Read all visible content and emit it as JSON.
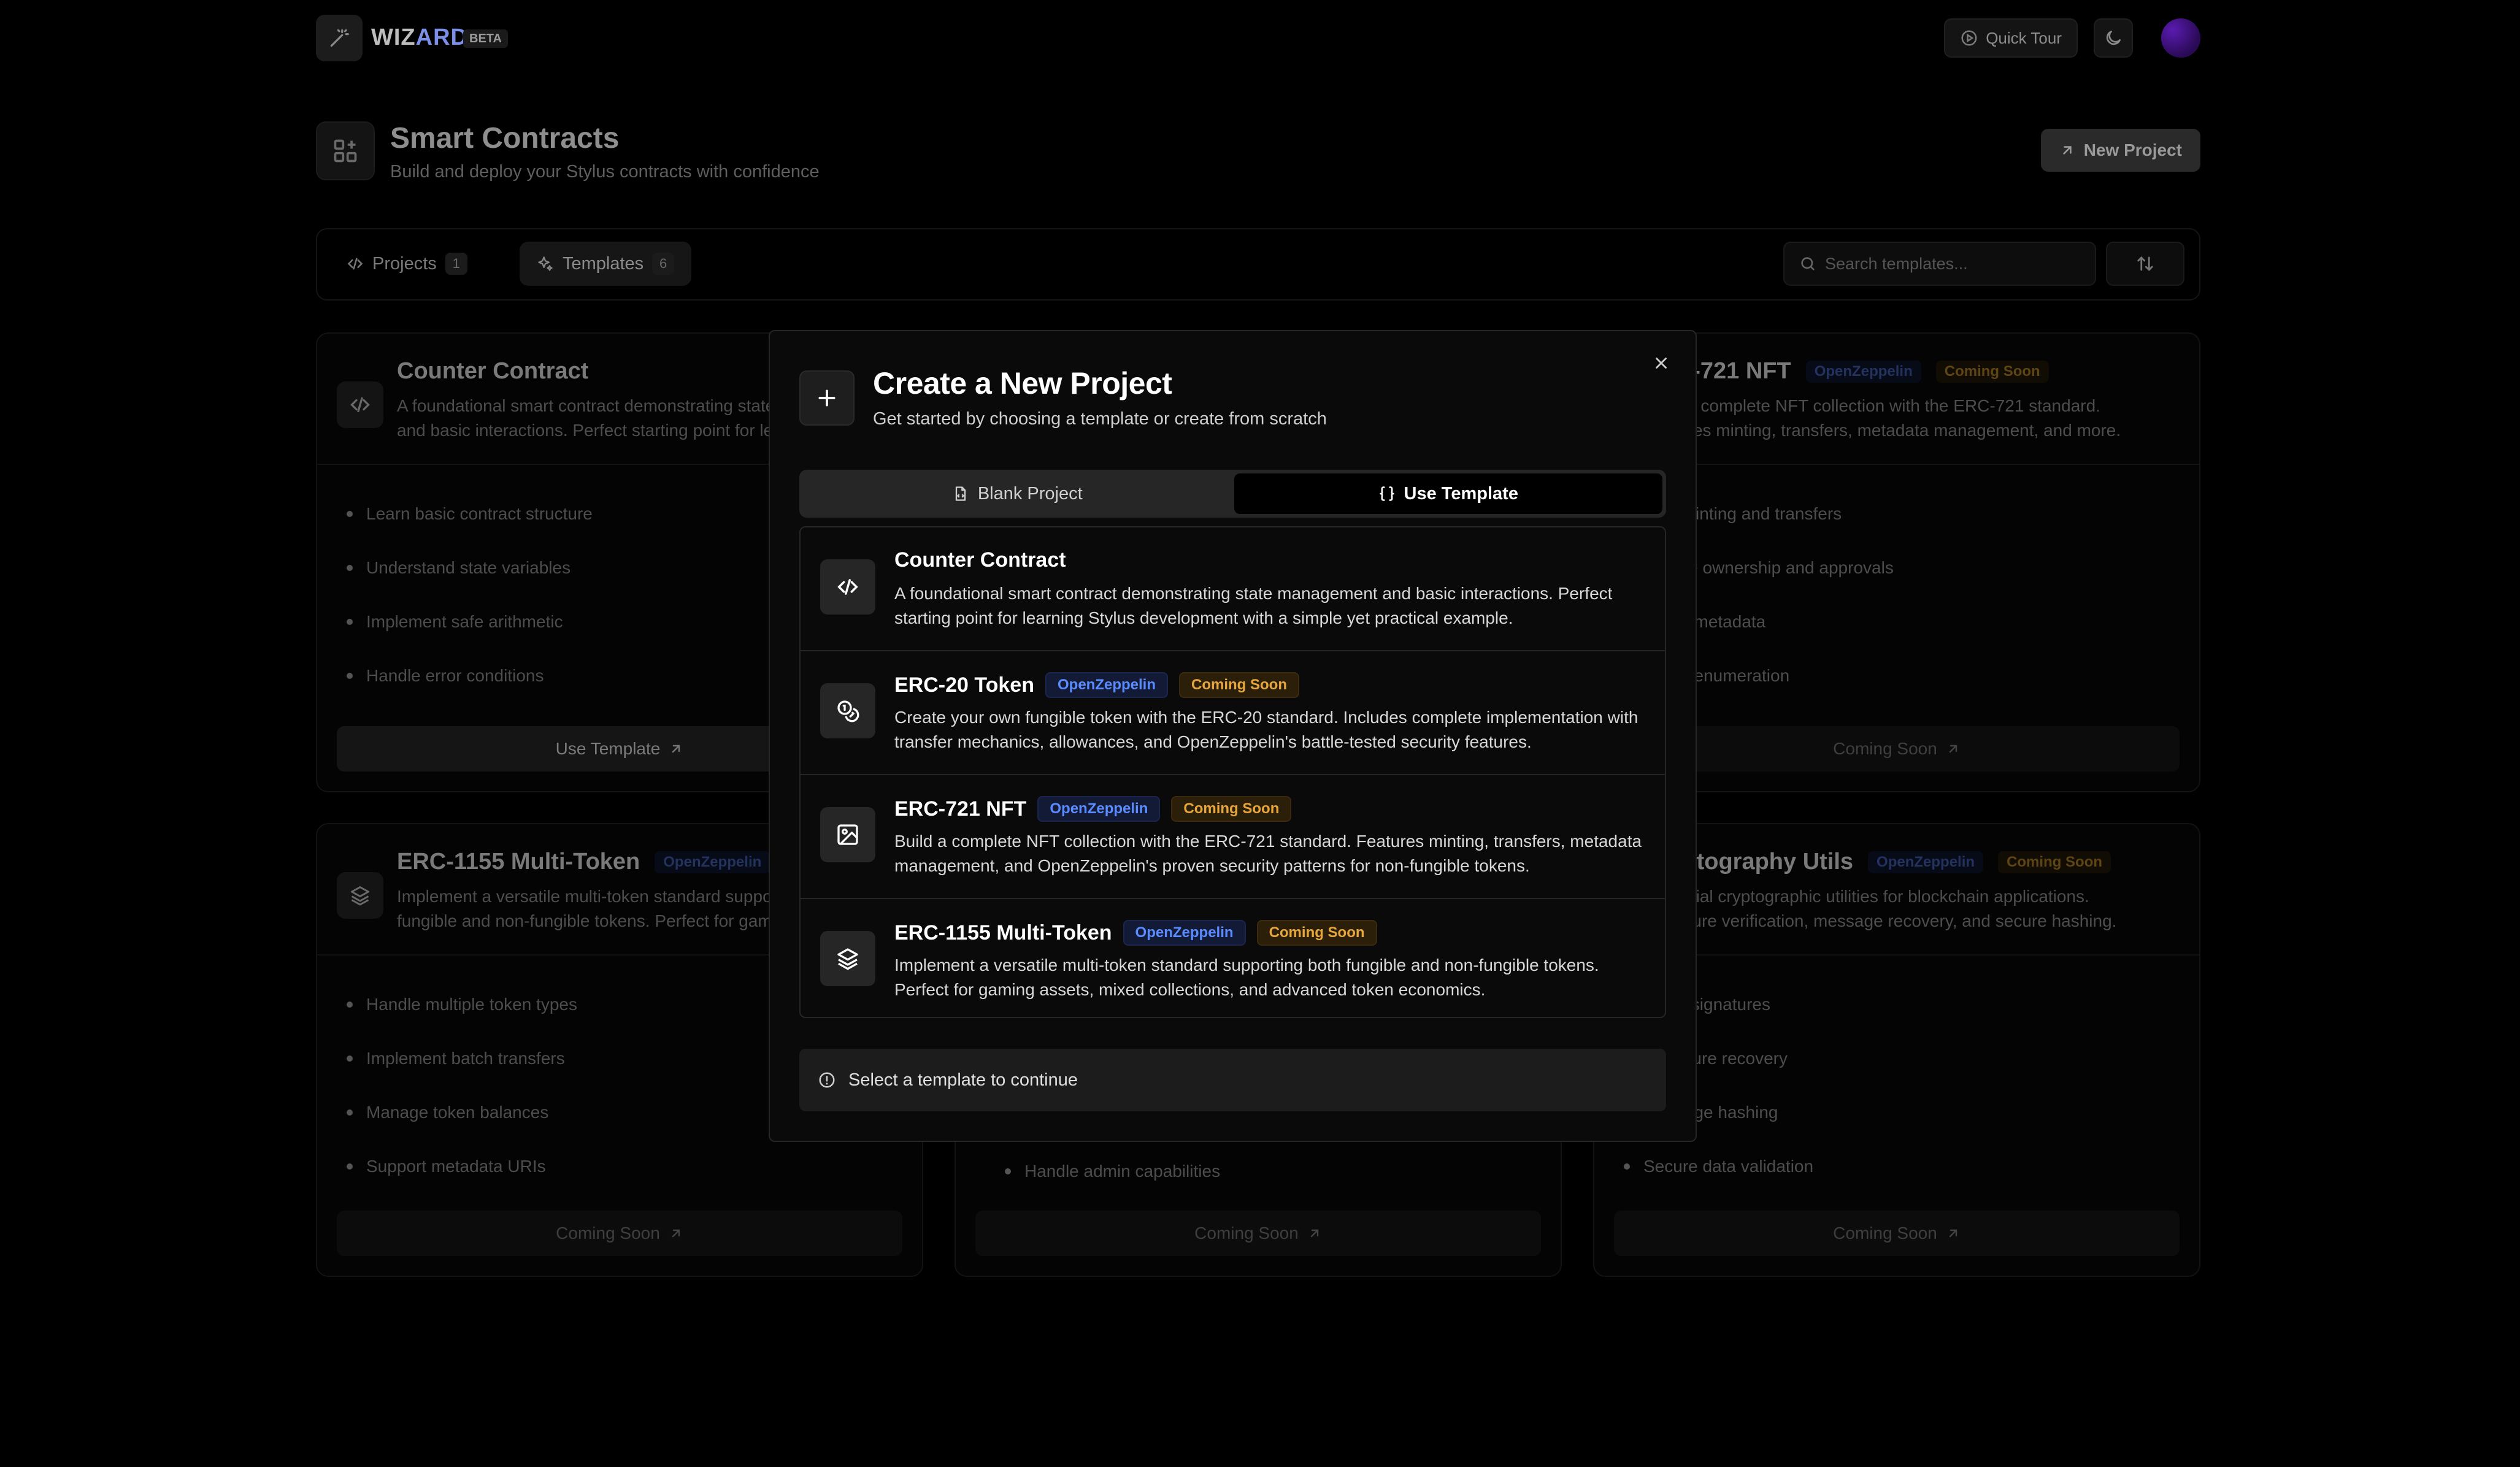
{
  "app": {
    "brand_main": "WIZ",
    "brand_accent": "ARD",
    "beta": "BETA",
    "quick_tour": "Quick Tour",
    "page_title": "Smart Contracts",
    "page_subtitle": "Build and deploy your Stylus contracts with confidence",
    "new_project": "New Project",
    "tabs": [
      {
        "label": "Projects",
        "count": "1"
      },
      {
        "label": "Templates",
        "count": "6"
      }
    ],
    "search_placeholder": "Search templates...",
    "cards": [
      {
        "title": "Counter Contract",
        "description": "A foundational smart contract demonstrating state management and basic interactions. Perfect starting point for learning Stylus development.",
        "features": [
          "Learn basic contract structure",
          "Understand state variables",
          "Implement safe arithmetic",
          "Handle error conditions"
        ],
        "button": "Use Template"
      },
      {
        "title": "ERC-721 NFT",
        "badge1": "OpenZeppelin",
        "badge2": "Coming Soon",
        "description": "Build a complete NFT collection with the ERC-721 standard. Features minting, transfers, metadata management, and more.",
        "features": [
          "NFT minting and transfers",
          "Handle ownership and approvals",
          "Token metadata",
          "Token enumeration"
        ],
        "button": "Coming Soon"
      },
      {
        "title": "ERC-1155 Multi-Token",
        "badge1": "OpenZeppelin",
        "description": "Implement a versatile multi-token standard supporting both fungible and non-fungible tokens. Perfect for gaming assets.",
        "features": [
          "Handle multiple token types",
          "Implement batch transfers",
          "Manage token balances",
          "Support metadata URIs"
        ],
        "button": "Coming Soon"
      },
      {
        "features": [
          "Handle admin capabilities"
        ],
        "button": "Coming Soon"
      },
      {
        "title": "Cryptography Utils",
        "badge1": "OpenZeppelin",
        "badge2": "Coming Soon",
        "description": "Essential cryptographic utilities for blockchain applications. Signature verification, message recovery, and secure hashing.",
        "features": [
          "Verify signatures",
          "Signature recovery",
          "Message hashing",
          "Secure data validation"
        ],
        "button": "Coming Soon"
      }
    ]
  },
  "modal": {
    "title": "Create a New Project",
    "subtitle": "Get started by choosing a template or create from scratch",
    "seg_blank": "Blank Project",
    "seg_template": "Use Template",
    "templates": [
      {
        "title": "Counter Contract",
        "description": "A foundational smart contract demonstrating state management and basic interactions. Perfect starting point for learning Stylus development with a simple yet practical example."
      },
      {
        "title": "ERC-20 Token",
        "badge_oz": "OpenZeppelin",
        "badge_soon": "Coming Soon",
        "description": "Create your own fungible token with the ERC-20 standard. Includes complete implementation with transfer mechanics, allowances, and OpenZeppelin's battle-tested security features."
      },
      {
        "title": "ERC-721 NFT",
        "badge_oz": "OpenZeppelin",
        "badge_soon": "Coming Soon",
        "description": "Build a complete NFT collection with the ERC-721 standard. Features minting, transfers, metadata management, and OpenZeppelin's proven security patterns for non-fungible tokens."
      },
      {
        "title": "ERC-1155 Multi-Token",
        "badge_oz": "OpenZeppelin",
        "badge_soon": "Coming Soon",
        "description": "Implement a versatile multi-token standard supporting both fungible and non-fungible tokens. Perfect for gaming assets, mixed collections, and advanced token economics."
      }
    ],
    "notice": "Select a template to continue"
  },
  "icons": [
    "wand-icon",
    "play-circle-icon",
    "moon-icon",
    "grid-plus-icon",
    "arrow-up-right-icon",
    "code-icon",
    "sparkles-icon",
    "search-icon",
    "sort-icon",
    "close-icon",
    "plus-icon",
    "file-icon",
    "braces-icon",
    "coins-icon",
    "image-icon",
    "layers-icon",
    "info-icon"
  ],
  "colors": {
    "openzeppelin_badge": "#5b8cff",
    "coming_soon_badge": "#e7a73c"
  }
}
